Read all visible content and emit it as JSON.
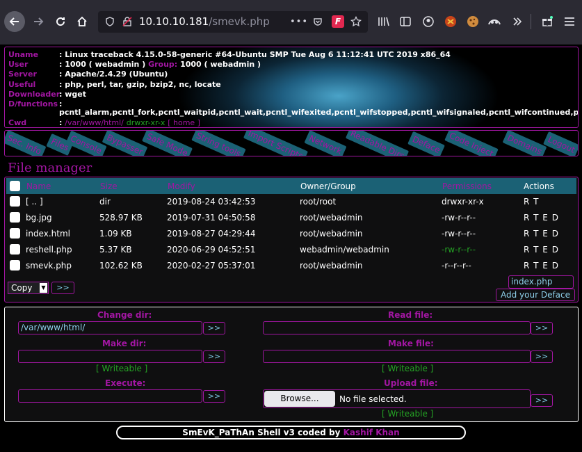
{
  "browser": {
    "url_host": "10.10.10.181",
    "url_path": "/smevk.php",
    "more_glyph": "•••"
  },
  "info": {
    "rows": [
      {
        "key": "Uname",
        "value": ": Linux traceback 4.15.0-58-generic #64-Ubuntu SMP Tue Aug 6 11:12:41 UTC 2019 x86_64"
      },
      {
        "key": "User",
        "value": ": 1000 ( webadmin )",
        "extra_key": "Group:",
        "extra_value": "1000 ( webadmin )"
      },
      {
        "key": "Server",
        "value": ": Apache/2.4.29 (Ubuntu)"
      },
      {
        "key": "Useful",
        "value": ": php, perl, tar, gzip, bzip2, nc, locate"
      },
      {
        "key": "Downloader",
        "value": ": wget"
      },
      {
        "key": "D/functions",
        "value": ":"
      },
      {
        "key": "Cwd",
        "value": ":",
        "cwd_path": "/var/www/html/",
        "cwd_perm": "drwxr-xr-x",
        "home": "[ home ]"
      }
    ],
    "disabled_functions": "pcntl_alarm,pcntl_fork,pcntl_waitpid,pcntl_wait,pcntl_wifexited,pcntl_wifstopped,pcntl_wifsignaled,pcntl_wifcontinued,pcntl_wexitsta"
  },
  "menu": [
    "Sec. Info",
    "Files",
    "Console",
    "Bypasser",
    "Safe Mode",
    "String tools",
    "Import Scripts",
    "Network",
    "Readable Dirs",
    "Deface",
    "Code Inject",
    "Domains",
    "Logout"
  ],
  "file_manager": {
    "title": "File manager",
    "headers": {
      "name": "Name",
      "size": "Size",
      "modify": "Modify",
      "owner": "Owner/Group",
      "perms": "Permissions",
      "actions": "Actions"
    },
    "rows": [
      {
        "name": "[ .. ]",
        "size": "dir",
        "modify": "2019-08-24 03:42:53",
        "owner": "root/root",
        "perms": "drwxr-xr-x",
        "perm_color": "#ffffff",
        "actions": "R T"
      },
      {
        "name": "bg.jpg",
        "size": "528.97 KB",
        "modify": "2019-07-31 04:50:58",
        "owner": "root/webadmin",
        "perms": "-rw-r--r--",
        "perm_color": "#ffffff",
        "actions": "R T E D"
      },
      {
        "name": "index.html",
        "size": "1.09 KB",
        "modify": "2019-08-27 04:29:44",
        "owner": "root/webadmin",
        "perms": "-rw-r--r--",
        "perm_color": "#ffffff",
        "actions": "R T E D"
      },
      {
        "name": "reshell.php",
        "size": "5.37 KB",
        "modify": "2020-06-29 04:52:51",
        "owner": "webadmin/webadmin",
        "perms": "-rw-r--r--",
        "perm_color": "#25a325",
        "actions": "R T E D"
      },
      {
        "name": "smevk.php",
        "size": "102.62 KB",
        "modify": "2020-02-27 05:37:01",
        "owner": "root/webadmin",
        "perms": "-r--r--r--",
        "perm_color": "#ffffff",
        "actions": "R T E D"
      }
    ],
    "copy_select": "Copy",
    "go": ">>",
    "deface_file": "index.php",
    "deface_button": "Add your Deface"
  },
  "tools": {
    "change_dir": {
      "label": "Change dir:",
      "value": "/var/www/html/"
    },
    "read_file": {
      "label": "Read file:",
      "value": ""
    },
    "make_dir": {
      "label": "Make dir:",
      "value": "",
      "status": "[ Writeable ]"
    },
    "make_file": {
      "label": "Make file:",
      "value": "",
      "status": "[ Writeable ]"
    },
    "execute": {
      "label": "Execute:",
      "value": ""
    },
    "upload": {
      "label": "Upload file:",
      "browse": "Browse...",
      "no_file": "No file selected.",
      "status": "[ Writeable ]"
    },
    "go": ">>"
  },
  "footer": {
    "text": "SmEvK_PaThAn Shell v3 coded by",
    "author": "Kashif Khan"
  }
}
